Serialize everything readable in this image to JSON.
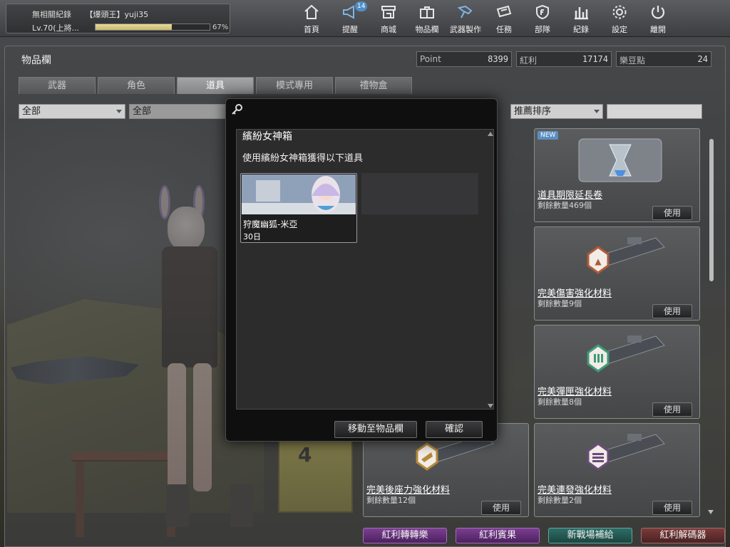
{
  "player": {
    "title": "無相關紀錄",
    "name": "【爆頭王】yuji35",
    "level": "Lv.70(上將...",
    "xp_percent_label": "67%",
    "xp_fraction": 0.67
  },
  "nav": [
    {
      "label": "首頁",
      "icon": "home-icon"
    },
    {
      "label": "提醒",
      "icon": "megaphone-icon",
      "badge": "14"
    },
    {
      "label": "商城",
      "icon": "shop-icon"
    },
    {
      "label": "物品欄",
      "icon": "briefcase-icon"
    },
    {
      "label": "武器製作",
      "icon": "weapon-craft-icon"
    },
    {
      "label": "任務",
      "icon": "mission-icon"
    },
    {
      "label": "部隊",
      "icon": "shield-icon"
    },
    {
      "label": "紀錄",
      "icon": "bar-chart-icon"
    },
    {
      "label": "設定",
      "icon": "gear-icon"
    },
    {
      "label": "離開",
      "icon": "power-icon"
    }
  ],
  "inventory": {
    "title": "物品欄",
    "currencies": [
      {
        "label": "Point",
        "value": "8399"
      },
      {
        "label": "紅利",
        "value": "17174"
      },
      {
        "label": "樂豆點",
        "value": "24"
      }
    ],
    "tabs": [
      "武器",
      "角色",
      "道具",
      "模式專用",
      "禮物盒"
    ],
    "active_tab": 2,
    "filter1": "全部",
    "filter2": "全部",
    "sort": "推薦排序",
    "search_value": ""
  },
  "items": [
    {
      "name": "道具期限延長卷",
      "qty": "剩餘數量469個",
      "use": "使用",
      "new": "NEW",
      "icon": "hourglass-trophy-icon"
    },
    {
      "name": "完美傷害強化材料",
      "qty": "剩餘數量9個",
      "use": "使用",
      "icon": "damage-material-icon"
    },
    {
      "name": "完美彈匣強化材料",
      "qty": "剩餘數量8個",
      "use": "使用",
      "icon": "magazine-material-icon"
    },
    {
      "name": "完美後座力強化材料",
      "qty": "剩餘數量12個",
      "use": "使用",
      "icon": "recoil-material-icon"
    },
    {
      "name": "完美連發強化材料",
      "qty": "剩餘數量2個",
      "use": "使用",
      "icon": "rapid-fire-material-icon"
    }
  ],
  "bottom_buttons": [
    "紅利轉轉樂",
    "紅利賓果",
    "新戰場補給",
    "紅利解碼器"
  ],
  "modal": {
    "title": "繽紛女神箱",
    "subtitle": "使用繽紛女神箱獲得以下道具",
    "reward": {
      "name": "狩魔幽狐-米亞",
      "duration": "30日"
    },
    "move_button": "移動至物品欄",
    "confirm_button": "確認"
  },
  "colors": {
    "accent_blue": "#5b8fc0",
    "purple_button": "#7a3f8f",
    "teal_button": "#2e6d66",
    "maroon_button": "#7a3b3b"
  }
}
